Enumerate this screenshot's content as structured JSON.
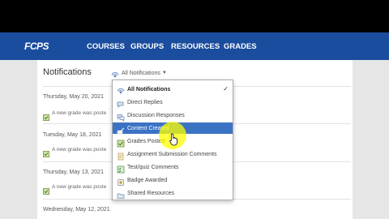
{
  "nav": {
    "logo": "FCPS",
    "items": [
      "COURSES",
      "GROUPS",
      "RESOURCES",
      "GRADES"
    ]
  },
  "page": {
    "title": "Notifications",
    "filter_label": "All Notifications"
  },
  "feed": [
    {
      "date": "Thursday, May 20, 2021",
      "text": "A new grade was poste"
    },
    {
      "date": "Tuesday, May 18, 2021",
      "text": "A new grade was poste"
    },
    {
      "date": "Thursday, May 13, 2021",
      "text": "A new grade was poste"
    },
    {
      "date": "Wednesday, May 12, 2021",
      "text": ""
    }
  ],
  "dropdown": {
    "items": [
      {
        "label": "All Notifications",
        "icon": "broadcast-icon",
        "checked": true,
        "bold": true
      },
      {
        "label": "Direct Replies",
        "icon": "reply-icon"
      },
      {
        "label": "Discussion Responses",
        "icon": "discussion-icon"
      },
      {
        "label": "Content Created",
        "icon": "content-created-icon",
        "highlighted": true
      },
      {
        "label": "Grades Posted",
        "icon": "grades-icon"
      },
      {
        "label": "Assignment Submission Comments",
        "icon": "assignment-icon"
      },
      {
        "label": "Test/quiz Comments",
        "icon": "quiz-icon"
      },
      {
        "label": "Badge Awarded",
        "icon": "badge-icon"
      },
      {
        "label": "Shared Resources",
        "icon": "shared-resources-icon"
      }
    ],
    "checkmark": "✓"
  },
  "colors": {
    "nav_bg": "#1b4d9e",
    "selected_bg": "#3b73c4",
    "cursor_highlight": "#ffff00"
  }
}
